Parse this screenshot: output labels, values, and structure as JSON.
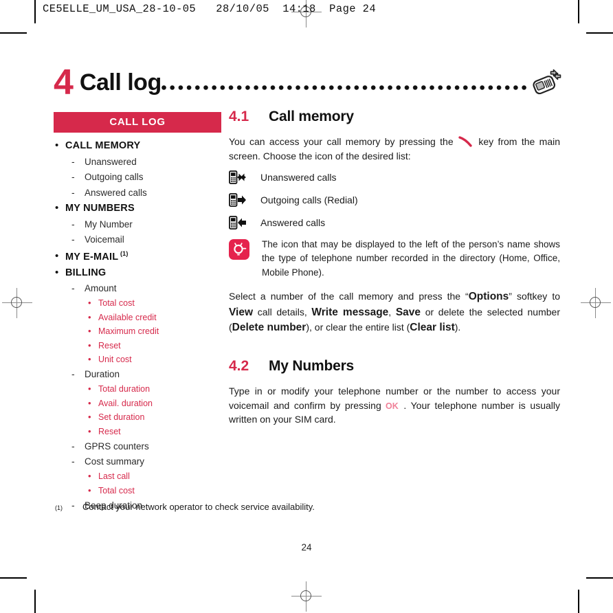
{
  "scan": {
    "header_line": "CE5ELLE_UM_USA_28-10-05   28/10/05  14:18  Page 24"
  },
  "colors": {
    "accent_red": "#d6294b",
    "text": "#1a1a1a",
    "white": "#ffffff"
  },
  "chapter": {
    "number": "4",
    "title": "Call log",
    "leader": "..............................................",
    "icon": "mobile-phone-exchange-icon"
  },
  "sidebar": {
    "header": "CALL LOG",
    "items": [
      {
        "level": 1,
        "label": "CALL MEMORY",
        "sup": ""
      },
      {
        "level": 2,
        "label": "Unanswered"
      },
      {
        "level": 2,
        "label": "Outgoing calls"
      },
      {
        "level": 2,
        "label": "Answered calls"
      },
      {
        "level": 1,
        "label": "MY NUMBERS",
        "sup": ""
      },
      {
        "level": 2,
        "label": "My Number"
      },
      {
        "level": 2,
        "label": "Voicemail"
      },
      {
        "level": 1,
        "label": "MY E-MAIL",
        "sup": "(1)"
      },
      {
        "level": 1,
        "label": "BILLING",
        "sup": ""
      },
      {
        "level": 2,
        "label": "Amount"
      },
      {
        "level": 3,
        "label": "Total cost"
      },
      {
        "level": 3,
        "label": "Available credit"
      },
      {
        "level": 3,
        "label": "Maximum credit"
      },
      {
        "level": 3,
        "label": "Reset"
      },
      {
        "level": 3,
        "label": "Unit cost"
      },
      {
        "level": 2,
        "label": "Duration"
      },
      {
        "level": 3,
        "label": "Total duration"
      },
      {
        "level": 3,
        "label": "Avail. duration"
      },
      {
        "level": 3,
        "label": "Set duration"
      },
      {
        "level": 3,
        "label": "Reset"
      },
      {
        "level": 2,
        "label": "GPRS counters"
      },
      {
        "level": 2,
        "label": "Cost summary"
      },
      {
        "level": 3,
        "label": "Last call"
      },
      {
        "level": 3,
        "label": "Total cost"
      },
      {
        "level": 2,
        "label": "Beep duration"
      }
    ]
  },
  "main": {
    "section_41": {
      "number": "4.1",
      "title": "Call memory",
      "intro_part1": "You can access your call memory by pressing the",
      "intro_part2": "key from the main screen. Choose the icon of the desired list:",
      "call_types": [
        {
          "icon": "phone-missed-call-icon",
          "label": "Unanswered calls"
        },
        {
          "icon": "phone-outgoing-call-icon",
          "label": "Outgoing calls (Redial)"
        },
        {
          "icon": "phone-incoming-call-icon",
          "label": "Answered calls"
        }
      ],
      "tip": {
        "icon": "lightbulb-tip-icon",
        "text": "The icon that may be displayed to the left of the person’s name shows the type of telephone number recorded in the directory (Home, Office, Mobile Phone)."
      },
      "options_para": {
        "p1": "Select a number of the call memory and press the “",
        "b1": "Options",
        "p2": "” softkey to ",
        "b2": "View",
        "p3": " call details, ",
        "b3": "Write message",
        "p4": ", ",
        "b4": "Save",
        "p5": " or delete the selected number (",
        "b5": "Delete number",
        "p6": "), or clear the entire list (",
        "b6": "Clear list",
        "p7": ")."
      }
    },
    "section_42": {
      "number": "4.2",
      "title": "My Numbers",
      "para_part1": "Type in or modify your telephone number or the number to access your voicemail and confirm by pressing",
      "ok_icon": "ok-key-icon",
      "para_part2": ". Your telephone number is usually written on your SIM card."
    }
  },
  "footnote": {
    "marker": "(1)",
    "text": "Contact your network operator to check service availability."
  },
  "folio": {
    "page_number": "24"
  }
}
